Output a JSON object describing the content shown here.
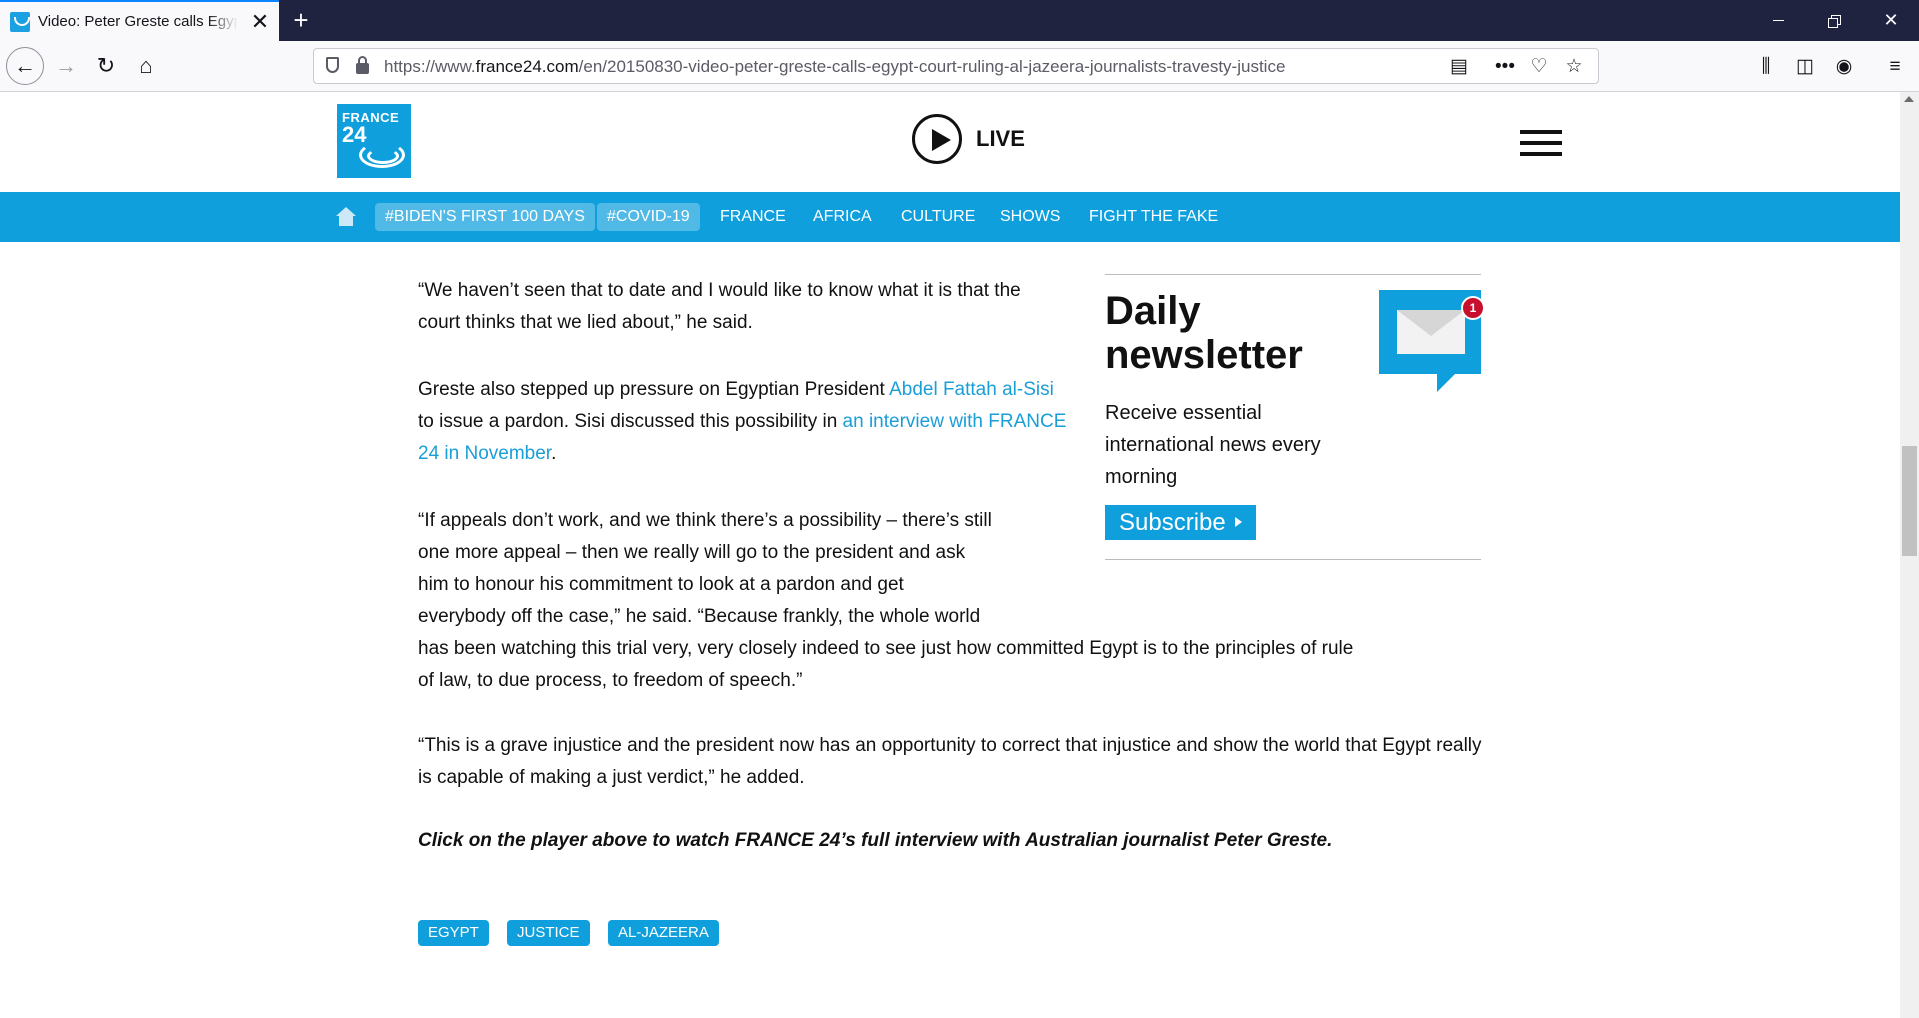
{
  "browser": {
    "tab_title": "Video: Peter Greste calls Egypt court ruling",
    "tab_close": "✕",
    "new_tab": "+",
    "url_prefix": "https://www.",
    "url_domain": "france24.com",
    "url_path": "/en/20150830-video-peter-greste-calls-egypt-court-ruling-al-jazeera-journalists-travesty-justice",
    "icons": [
      "shield-icon",
      "lock-icon",
      "reader-view-icon",
      "more-icon",
      "pocket-icon",
      "star-icon",
      "library-icon",
      "sidebar-icon",
      "account-icon",
      "menu-icon"
    ]
  },
  "site": {
    "logo_line1": "FRANCE",
    "logo_line2": "24",
    "live_label": "LIVE",
    "nav": {
      "pills": [
        "#BIDEN'S FIRST 100 DAYS",
        "#COVID-19"
      ],
      "links": [
        "FRANCE",
        "AFRICA",
        "CULTURE",
        "SHOWS",
        "FIGHT THE FAKE"
      ]
    }
  },
  "article": {
    "p1": "“We haven’t seen that to date and I would like to know what it is that the court thinks that we lied about,” he said.",
    "p2_a": "Greste also stepped up pressure on Egyptian President ",
    "p2_link1": "Abdel Fattah al-Sisi",
    "p2_b": " to issue a pardon. Sisi discussed this possibility in ",
    "p2_link2": "an interview with FRANCE 24 in November",
    "p2_c": ".",
    "p3_l1": "“If appeals don’t work, and we think there’s a possibility – there’s still",
    "p3_l2": "one more appeal – then we really will go to the president and ask",
    "p3_l3": "him to honour his commitment to look at a pardon and get",
    "p3_l4": "everybody off the case,” he said. “Because frankly, the whole world",
    "p3_l5": "has been watching this trial very, very closely indeed to see just how committed Egypt is to the principles of rule",
    "p3_l6": "of law, to due process, to freedom of speech.”",
    "p4": "“This is a grave injustice and the president now has an opportunity to correct that injustice and show the world that Egypt really is capable of making a just verdict,” he added.",
    "closing": "Click on the player above to watch FRANCE 24’s full interview with Australian journalist Peter Greste.",
    "tags": [
      "EGYPT",
      "JUSTICE",
      "AL-JAZEERA"
    ]
  },
  "newsletter": {
    "title": "Daily newsletter",
    "text": "Receive essential international news every morning",
    "button": "Subscribe",
    "badge": "1"
  },
  "colors": {
    "brand": "#0f9fdc",
    "link": "#1a9ed8",
    "tabbar": "#202340"
  }
}
